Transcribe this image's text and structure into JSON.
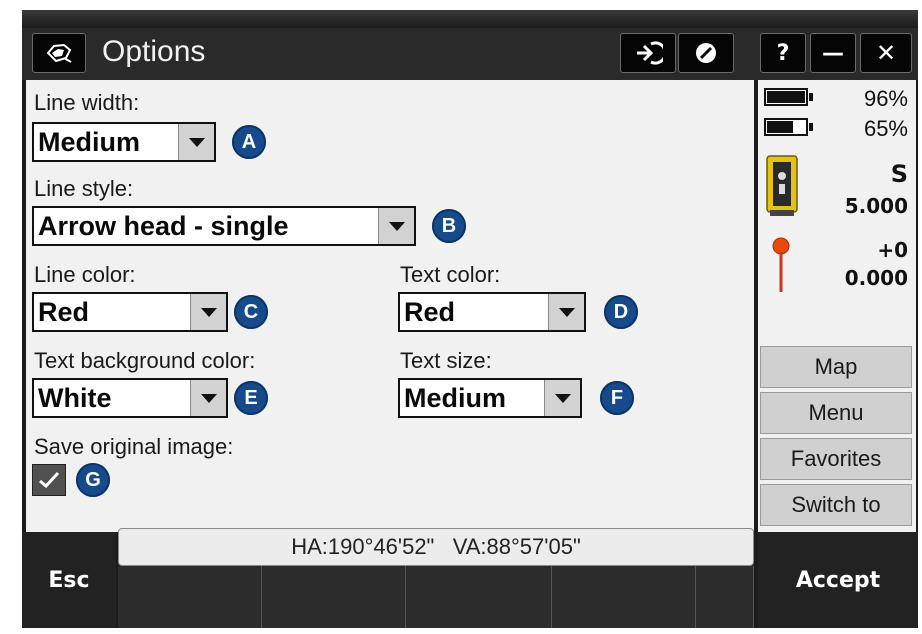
{
  "window": {
    "title": "Options",
    "buttons": [
      {
        "name": "login-icon",
        "label": ""
      },
      {
        "name": "disable-icon",
        "label": ""
      },
      {
        "name": "help-button",
        "label": "?"
      },
      {
        "name": "minimize-button",
        "label": "—"
      },
      {
        "name": "close-button",
        "label": "✕"
      }
    ]
  },
  "options": {
    "line_width": {
      "label": "Line width:",
      "value": "Medium",
      "marker": "A"
    },
    "line_style": {
      "label": "Line style:",
      "value": "Arrow head - single",
      "marker": "B"
    },
    "line_color": {
      "label": "Line color:",
      "value": "Red",
      "marker": "C"
    },
    "text_color": {
      "label": "Text color:",
      "value": "Red",
      "marker": "D"
    },
    "text_bg_color": {
      "label": "Text background color:",
      "value": "White",
      "marker": "E"
    },
    "text_size": {
      "label": "Text size:",
      "value": "Medium",
      "marker": "F"
    },
    "save_original": {
      "label": "Save original image:",
      "checked": true,
      "marker": "G"
    }
  },
  "status": {
    "angles": "HA:190°46'52\"   VA:88°57'05\""
  },
  "panel": {
    "battery1": {
      "pct": "96%",
      "level": 0.96
    },
    "battery2": {
      "pct": "65%",
      "level": 0.65
    },
    "instrument_mode": "S",
    "instrument_value": "5.000",
    "target_offset": "+0",
    "target_value": "0.000",
    "buttons": [
      "Map",
      "Menu",
      "Favorites",
      "Switch to"
    ]
  },
  "softkeys": {
    "esc": "Esc",
    "accept": "Accept"
  },
  "colors": {
    "marker": "#174a8b",
    "titlebar": "#2a2a2a",
    "content_bg": "#f1f1f1",
    "target_pin": "#e84a0c"
  }
}
